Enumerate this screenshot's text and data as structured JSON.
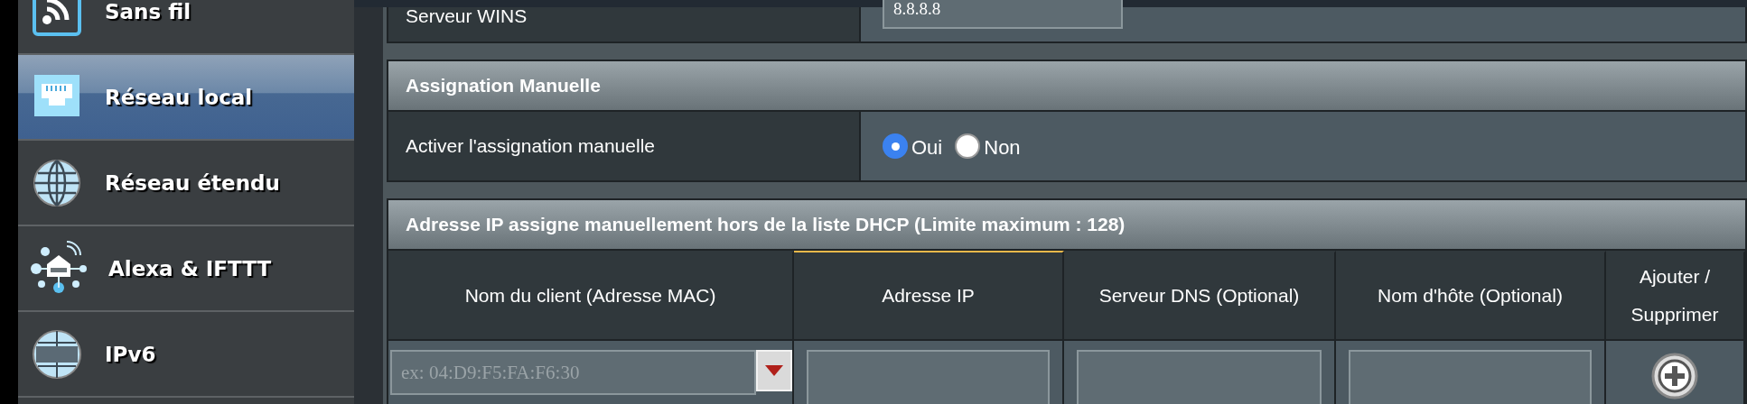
{
  "sidebar": {
    "items": [
      {
        "label": "Sans fil",
        "kind": "wifi",
        "selected": false
      },
      {
        "label": "Réseau local",
        "kind": "lan",
        "selected": true
      },
      {
        "label": "Réseau étendu",
        "kind": "globe",
        "selected": false
      },
      {
        "label": "Alexa & IFTTT",
        "kind": "hub",
        "selected": false
      },
      {
        "label": "IPv6",
        "kind": "ipv6",
        "selected": false
      }
    ]
  },
  "wins_row": {
    "label": "Serveur WINS",
    "value": "8.8.8.8"
  },
  "manual_section": {
    "title": "Assignation Manuelle",
    "label": "Activer l'assignation manuelle",
    "options": [
      {
        "label": "Oui",
        "selected": true
      },
      {
        "label": "Non",
        "selected": false
      }
    ]
  },
  "table": {
    "title": "Adresse IP assigne manuellement hors de la liste DHCP (Limite maximum : 128)",
    "columns": [
      {
        "label": "Nom du client (Adresse MAC)",
        "active": false
      },
      {
        "label": "Adresse IP",
        "active": true
      },
      {
        "label": "Serveur DNS (Optional)",
        "active": false
      },
      {
        "label": "Nom d'hôte (Optional)",
        "active": false
      },
      {
        "label": "Ajouter / Supprimer",
        "active": false
      }
    ],
    "mac_placeholder": "ex: 04:D9:F5:FA:F6:30"
  }
}
